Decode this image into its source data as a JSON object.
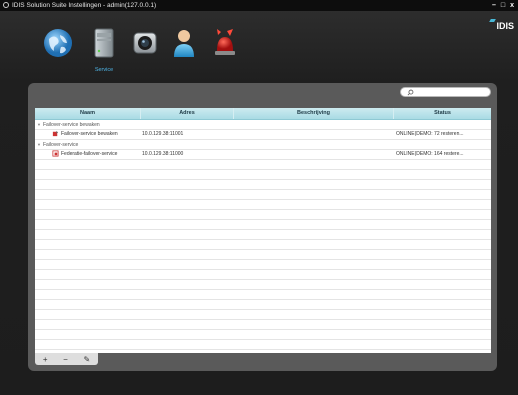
{
  "window": {
    "title": "IDIS Solution Suite Instellingen - admin(127.0.0.1)",
    "minimize": "–",
    "maximize": "□",
    "close": "x"
  },
  "brand": {
    "logo": "IDIS"
  },
  "toolbar": {
    "active_label": "Service",
    "icons": [
      "globe-icon",
      "server-icon",
      "camera-icon",
      "user-icon",
      "alarm-icon"
    ]
  },
  "search": {
    "placeholder": ""
  },
  "table": {
    "headers": {
      "name": "Naam",
      "address": "Adres",
      "description": "Beschrijving",
      "status": "Status"
    },
    "groups": [
      {
        "label": "Failover-service bewaken",
        "items": [
          {
            "name": "Failover-service bewaken",
            "address": "10.0.129.38:11001",
            "description": "",
            "status": "ONLINE(DEMO: 72 resteren..."
          }
        ]
      },
      {
        "label": "Failover-service",
        "items": [
          {
            "name": "Federatie-failover-service",
            "address": "10.0.129.38:11000",
            "description": "",
            "status": "ONLINE(DEMO: 164 restere..."
          }
        ]
      }
    ]
  },
  "actions": {
    "add": "+",
    "remove": "−",
    "edit": "✎"
  },
  "colors": {
    "accent": "#4fb6e8",
    "header": "#a9dbe4",
    "panel": "#5a5a5a"
  }
}
